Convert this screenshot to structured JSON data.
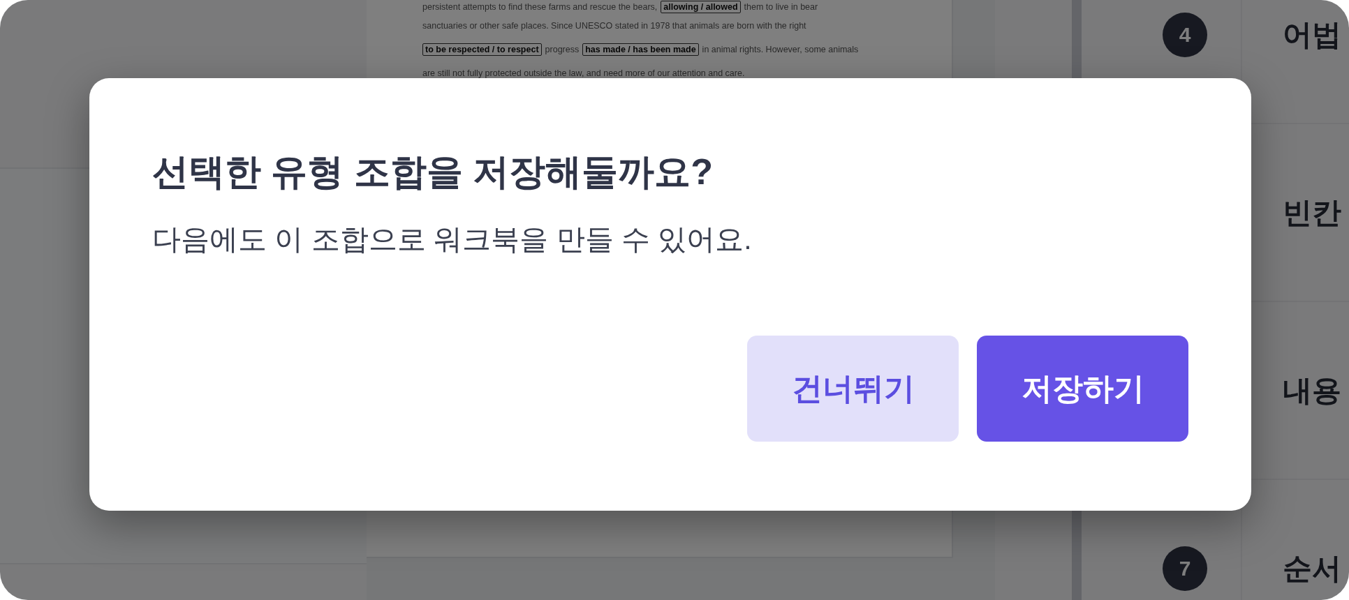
{
  "document": {
    "lines": [
      [
        {
          "kind": "plain",
          "text": "persistent attempts to find these farms and rescue the bears,"
        },
        {
          "kind": "choice",
          "text": "allowing / allowed"
        },
        {
          "kind": "plain",
          "text": "them to live in bear"
        }
      ],
      [
        {
          "kind": "plain",
          "text": "sanctuaries or other safe places. Since UNESCO stated in 1978 that animals are born with the right"
        }
      ],
      [
        {
          "kind": "choice",
          "text": "to be respected / to respect"
        },
        {
          "kind": "plain",
          "text": "progress"
        },
        {
          "kind": "choice",
          "text": "has made / has been made"
        },
        {
          "kind": "plain",
          "text": "in animal rights. However, some animals"
        }
      ],
      [
        {
          "kind": "plain",
          "text": "are still not fully protected outside the law, and need more of our attention and care."
        }
      ]
    ]
  },
  "question_types": [
    {
      "number": "4",
      "label": "어법"
    },
    {
      "label": "빈칸"
    },
    {
      "label": "내용"
    },
    {
      "number": "7",
      "label": "순서"
    }
  ],
  "dialog": {
    "title": "선택한 유형 조합을 저장해둘까요?",
    "message": "다음에도 이 조합으로 워크북을 만들 수 있어요.",
    "buttons": [
      {
        "label": "건너뛰기",
        "kind": "secondary"
      },
      {
        "label": "저장하기",
        "kind": "primary"
      }
    ]
  }
}
